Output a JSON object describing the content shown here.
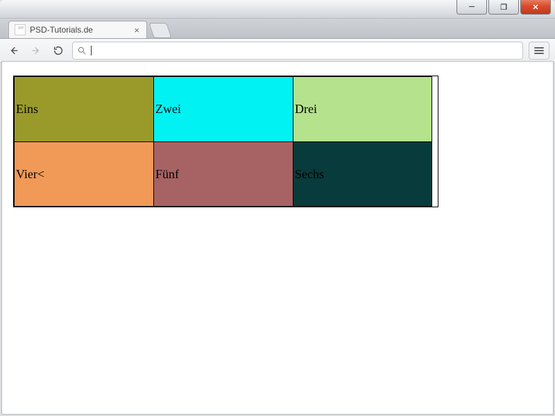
{
  "window": {
    "minimize_glyph": "─",
    "maximize_glyph": "❐",
    "close_glyph": "✕"
  },
  "tab": {
    "title": "PSD-Tutorials.de",
    "close_glyph": "×"
  },
  "address_bar": {
    "value": ""
  },
  "cells": {
    "c0": "Eins",
    "c1": "Zwei",
    "c2": "Drei",
    "c3": "Vier<",
    "c4": "Fünf",
    "c5": "Sechs"
  },
  "colors": {
    "c0": "#9a9a2a",
    "c1": "#00f2f2",
    "c2": "#b5e28c",
    "c3": "#f19a57",
    "c4": "#a76364",
    "c5": "#083b3b"
  }
}
